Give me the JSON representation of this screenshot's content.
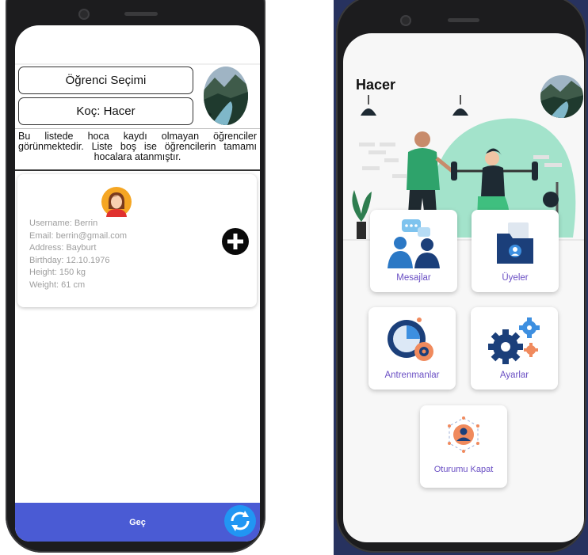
{
  "left_app": {
    "student_select_label": "Öğrenci Seçimi",
    "coach_label": "Koç: Hacer",
    "info_text": "Bu listede hoca kaydı olmayan öğrenciler görünmektedir. Liste boş ise öğrencilerin tamamı hocalara atanmıştır.",
    "student": {
      "username": "Username: Berrin",
      "email": "Email: berrin@gmail.com",
      "address": "Address: Bayburt",
      "birthday": "Birthday: 12.10.1976",
      "height": "Height: 150 kg",
      "weight": "Weight: 61 cm"
    },
    "next_button": "Geç",
    "icons": {
      "add": "plus-circle-icon",
      "refresh": "refresh-icon",
      "avatar": "female-avatar-icon"
    },
    "colors": {
      "bottom_bar": "#4a5bd4",
      "refresh": "#2196f3"
    }
  },
  "right_app": {
    "greeting": "Hacer",
    "tiles": {
      "messages": "Mesajlar",
      "members": "Üyeler",
      "trainings": "Antrenmanlar",
      "settings": "Ayarlar",
      "logout": "Oturumu Kapat"
    },
    "icons": {
      "messages": "chat-people-icon",
      "members": "member-folder-icon",
      "trainings": "stopwatch-gear-icon",
      "settings": "gears-icon",
      "logout": "user-logout-icon"
    },
    "colors": {
      "label": "#6a4fc4",
      "accent": "#5fd3a8"
    }
  }
}
